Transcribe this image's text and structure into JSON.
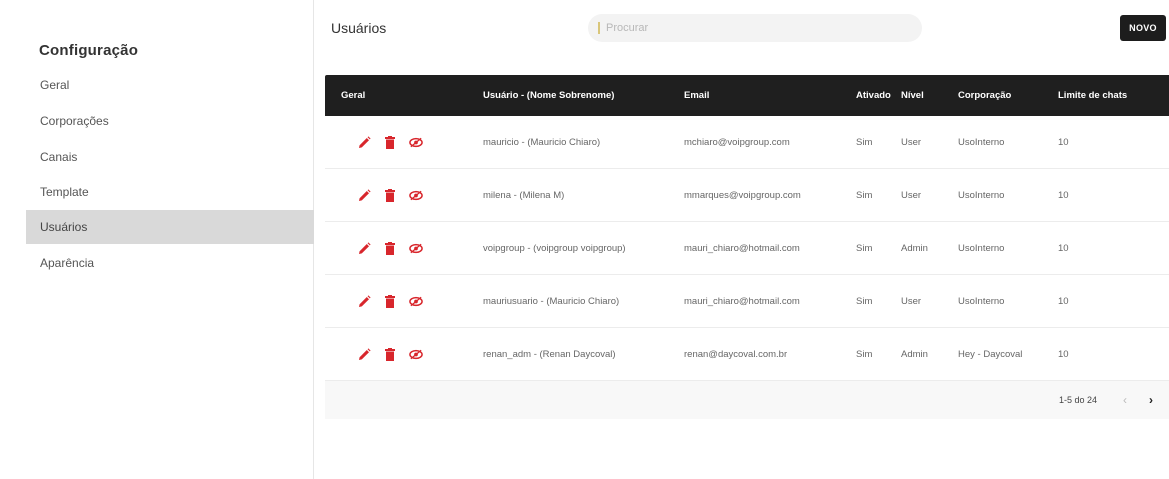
{
  "sidebar": {
    "title": "Configuração",
    "items": [
      {
        "label": "Geral"
      },
      {
        "label": "Corporações"
      },
      {
        "label": "Canais"
      },
      {
        "label": "Template"
      },
      {
        "label": "Usuários",
        "active": true
      },
      {
        "label": "Aparência"
      }
    ]
  },
  "header": {
    "title": "Usuários",
    "search_placeholder": "Procurar",
    "new_button": "NOVO"
  },
  "table": {
    "columns": [
      "Geral",
      "Usuário - (Nome Sobrenome)",
      "Email",
      "Ativado",
      "Nível",
      "Corporação",
      "Limite de chats"
    ],
    "rows": [
      {
        "user": "mauricio - (Mauricio Chiaro)",
        "email": "mchiaro@voipgroup.com",
        "active": "Sim",
        "level": "User",
        "corp": "UsoInterno",
        "limit": "10"
      },
      {
        "user": "milena - (Milena M)",
        "email": "mmarques@voipgroup.com",
        "active": "Sim",
        "level": "User",
        "corp": "UsoInterno",
        "limit": "10"
      },
      {
        "user": "voipgroup - (voipgroup voipgroup)",
        "email": "mauri_chiaro@hotmail.com",
        "active": "Sim",
        "level": "Admin",
        "corp": "UsoInterno",
        "limit": "10"
      },
      {
        "user": "mauriusuario - (Mauricio Chiaro)",
        "email": "mauri_chiaro@hotmail.com",
        "active": "Sim",
        "level": "User",
        "corp": "UsoInterno",
        "limit": "10"
      },
      {
        "user": "renan_adm - (Renan Daycoval)",
        "email": "renan@daycoval.com.br",
        "active": "Sim",
        "level": "Admin",
        "corp": "Hey - Daycoval",
        "limit": "10"
      }
    ],
    "icons": {
      "edit": "pencil-icon",
      "delete": "trash-icon",
      "view": "eye-icon"
    },
    "icon_color": "#d8262c"
  },
  "pagination": {
    "range": "1-5 do 24",
    "prev": "‹",
    "next": "›"
  }
}
